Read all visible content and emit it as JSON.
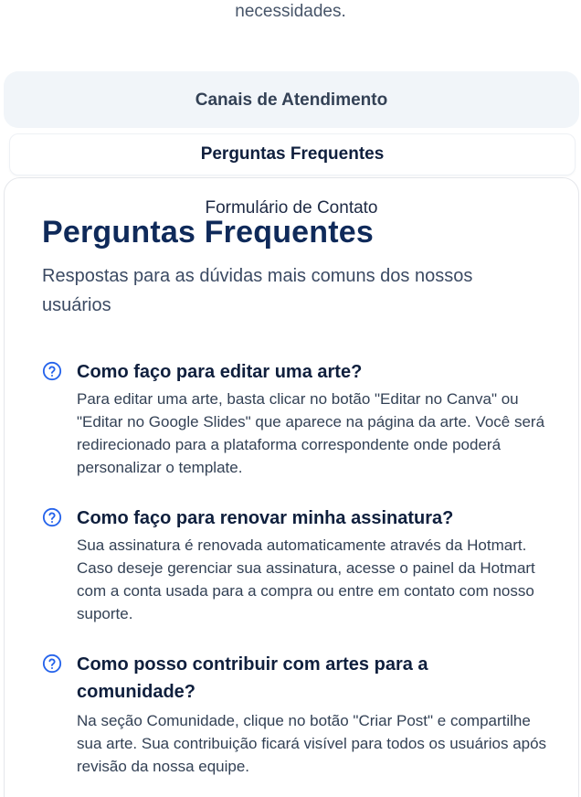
{
  "intro": {
    "text_tail": "necessidades."
  },
  "tabs": [
    {
      "label": "Canais de Atendimento"
    },
    {
      "label": "Perguntas Frequentes"
    },
    {
      "label": "Formulário de Contato"
    }
  ],
  "faq": {
    "title": "Perguntas Frequentes",
    "subtitle": "Respostas para as dúvidas mais comuns dos nossos usuários",
    "icon": "help-circle-icon",
    "accent_color": "#2563eb",
    "items": [
      {
        "question": "Como faço para editar uma arte?",
        "answer": "Para editar uma arte, basta clicar no botão \"Editar no Canva\" ou \"Editar no Google Slides\" que aparece na página da arte. Você será redirecionado para a plataforma correspondente onde poderá personalizar o template."
      },
      {
        "question": "Como faço para renovar minha assinatura?",
        "answer": "Sua assinatura é renovada automaticamente através da Hotmart. Caso deseje gerenciar sua assinatura, acesse o painel da Hotmart com a conta usada para a compra ou entre em contato com nosso suporte."
      },
      {
        "question": "Como posso contribuir com artes para a comunidade?",
        "answer": "Na seção Comunidade, clique no botão \"Criar Post\" e compartilhe sua arte. Sua contribuição ficará visível para todos os usuários após revisão da nossa equipe."
      }
    ]
  }
}
